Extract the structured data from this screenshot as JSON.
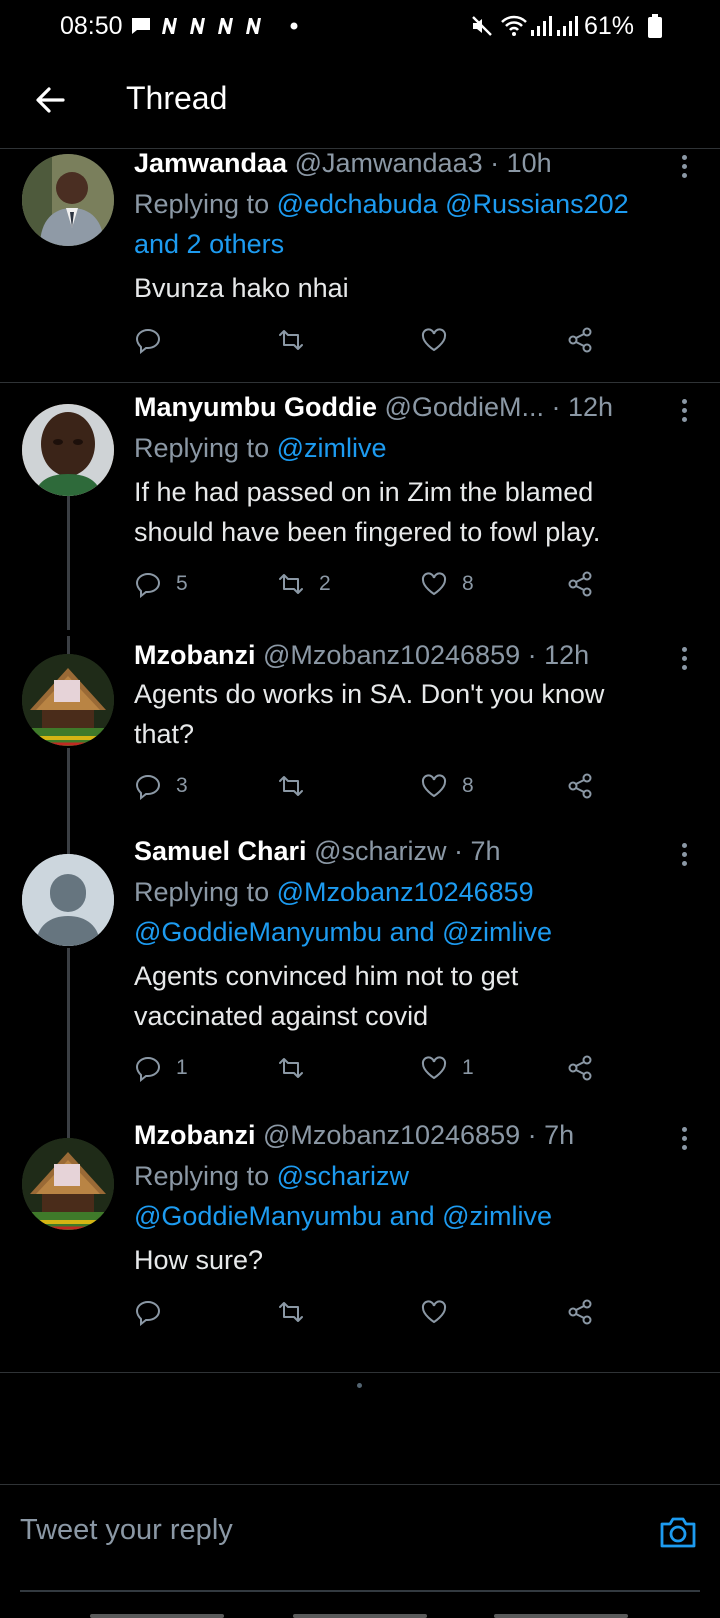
{
  "status_bar": {
    "time": "08:50",
    "battery": "61%",
    "icons": [
      "chat-bubble-icon",
      "news-n-icon",
      "news-n-icon",
      "news-n-icon",
      "news-n-icon",
      "dot-icon",
      "mute-icon",
      "wifi-icon",
      "signal-icon",
      "signal-icon",
      "battery-icon"
    ]
  },
  "header": {
    "title": "Thread",
    "back_icon": "arrow-left-icon"
  },
  "tweets": [
    {
      "name": "Jamwandaa",
      "handle": "@Jamwandaa3",
      "time": "· 10h",
      "replying_prefix": "Replying to",
      "mentions_line1": "@edchabuda @Russians202",
      "mentions_line2": "and 2 others",
      "text": "Bvunza hako nhai",
      "counts": {
        "replies": "",
        "retweets": "",
        "likes": ""
      }
    },
    {
      "name": "Manyumbu Goddie",
      "handle": "@GoddieM...",
      "time": "· 12h",
      "replying_prefix": "Replying to",
      "mentions_line1": "@zimlive",
      "text_line1": "If he had passed on in Zim the blamed",
      "text_line2": "should have been fingered to fowl play.",
      "counts": {
        "replies": "5",
        "retweets": "2",
        "likes": "8"
      }
    },
    {
      "name": "Mzobanzi",
      "handle": "@Mzobanz10246859",
      "time": "· 12h",
      "text_line1": "Agents do works in SA. Don't you know",
      "text_line2": "that?",
      "counts": {
        "replies": "3",
        "retweets": "",
        "likes": "8"
      }
    },
    {
      "name": "Samuel Chari",
      "handle": "@scharizw",
      "time": "· 7h",
      "replying_prefix": "Replying to",
      "mentions_line1": "@Mzobanz10246859",
      "mentions_line2_a": "@GoddieManyumbu",
      "mentions_line2_b": "and",
      "mentions_line2_c": "@zimlive",
      "text_line1": "Agents  convinced  him not to get",
      "text_line2": "vaccinated against covid",
      "counts": {
        "replies": "1",
        "retweets": "",
        "likes": "1"
      }
    },
    {
      "name": "Mzobanzi",
      "handle": "@Mzobanz10246859",
      "time": "· 7h",
      "replying_prefix": "Replying to",
      "mentions_line1": "@scharizw",
      "mentions_line2_a": "@GoddieManyumbu",
      "mentions_line2_b": "and",
      "mentions_line2_c": "@zimlive",
      "text": "How sure?",
      "counts": {
        "replies": "",
        "retweets": "",
        "likes": ""
      }
    }
  ],
  "compose": {
    "placeholder": "Tweet your reply",
    "camera_icon": "camera-icon"
  },
  "colors": {
    "background": "#000000",
    "text": "#e7e9ea",
    "muted": "#8b98a5",
    "link": "#1d9bf0",
    "divider": "#2f3336"
  }
}
